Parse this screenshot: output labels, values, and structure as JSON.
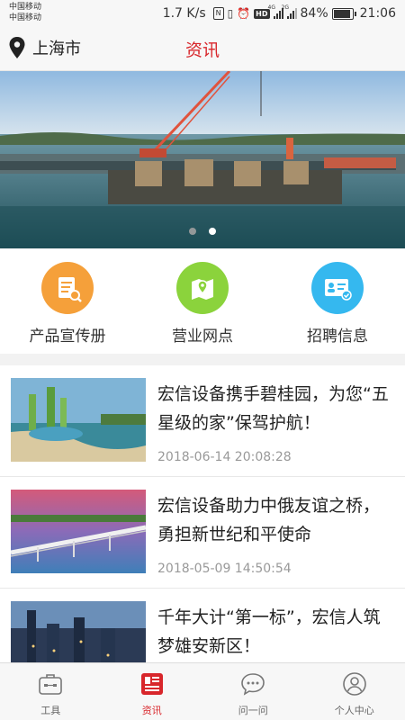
{
  "status_bar": {
    "carrier_1": "中国移动",
    "carrier_2": "中国移动",
    "speed": "1.7 K/s",
    "battery": "84%",
    "battery_level": 0.84,
    "time": "21:06",
    "net_4g": "4G",
    "net_2g": "2G",
    "hd": "HD",
    "nfc": "N"
  },
  "header": {
    "location": "上海市",
    "title": "资讯"
  },
  "banner": {
    "slide_count": 2,
    "active_index": 1
  },
  "quick_menu": [
    {
      "label": "产品宣传册",
      "icon": "brochure-icon",
      "color": "#f5a03a"
    },
    {
      "label": "营业网点",
      "icon": "map-icon",
      "color": "#8bd33c"
    },
    {
      "label": "招聘信息",
      "icon": "id-card-icon",
      "color": "#35b8ef"
    }
  ],
  "news": [
    {
      "title": "宏信设备携手碧桂园，为您“五星级的家”保驾护航！",
      "date": "2018-06-14 20:08:28"
    },
    {
      "title": "宏信设备助力中俄友谊之桥，勇担新世纪和平使命",
      "date": "2018-05-09 14:50:54"
    },
    {
      "title": "千年大计“第一标”，宏信人筑梦雄安新区！",
      "date": ""
    }
  ],
  "tabs": [
    {
      "label": "工具",
      "icon": "toolbox-icon",
      "active": false
    },
    {
      "label": "资讯",
      "icon": "newspaper-icon",
      "active": true
    },
    {
      "label": "问一问",
      "icon": "chat-icon",
      "active": false
    },
    {
      "label": "个人中心",
      "icon": "user-icon",
      "active": false
    }
  ],
  "colors": {
    "accent": "#d8262b",
    "text": "#222222",
    "muted": "#999999"
  }
}
